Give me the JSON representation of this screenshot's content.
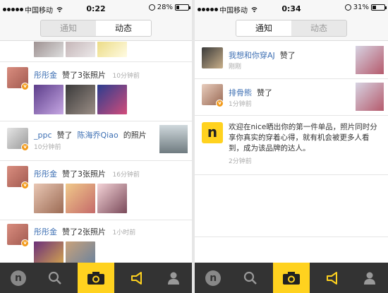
{
  "left": {
    "status": {
      "carrier": "中国移动",
      "time": "0:22",
      "battery": "28%",
      "battery_level": 0.28
    },
    "tabs": [
      {
        "label": "通知",
        "active": false
      },
      {
        "label": "动态",
        "active": true
      }
    ],
    "feed": [
      {
        "user": "彤彤金",
        "action": "赞了3张照片",
        "time": "10分钟前"
      },
      {
        "user": "_ppc",
        "action": "赞了",
        "target": "陈海乔Qiao",
        "suffix": "的照片",
        "time": "10分钟前"
      },
      {
        "user": "彤彤金",
        "action": "赞了3张照片",
        "time": "16分钟前"
      },
      {
        "user": "彤彤金",
        "action": "赞了2张照片",
        "time": "1小时前"
      }
    ]
  },
  "right": {
    "status": {
      "carrier": "中国移动",
      "time": "0:34",
      "battery": "31%",
      "battery_level": 0.31
    },
    "tabs": [
      {
        "label": "通知",
        "active": true
      },
      {
        "label": "动态",
        "active": false
      }
    ],
    "notifications": [
      {
        "user": "我想和你穿AJ",
        "action": "赞了",
        "time": "刚刚"
      },
      {
        "user": "排骨熊",
        "action": "赞了",
        "time": "1分钟前"
      },
      {
        "logo": "n",
        "message": "欢迎在nice晒出你的第一件单品，照片同时分享你真实的穿着心得，就有机会被更多人看到，成为该品牌的达人。",
        "time": "2分钟前"
      }
    ]
  },
  "colors": {
    "accent": "#ffd21f",
    "link": "#3d6fb3",
    "tabbar": "#333333",
    "badge": "#f29a1b"
  }
}
